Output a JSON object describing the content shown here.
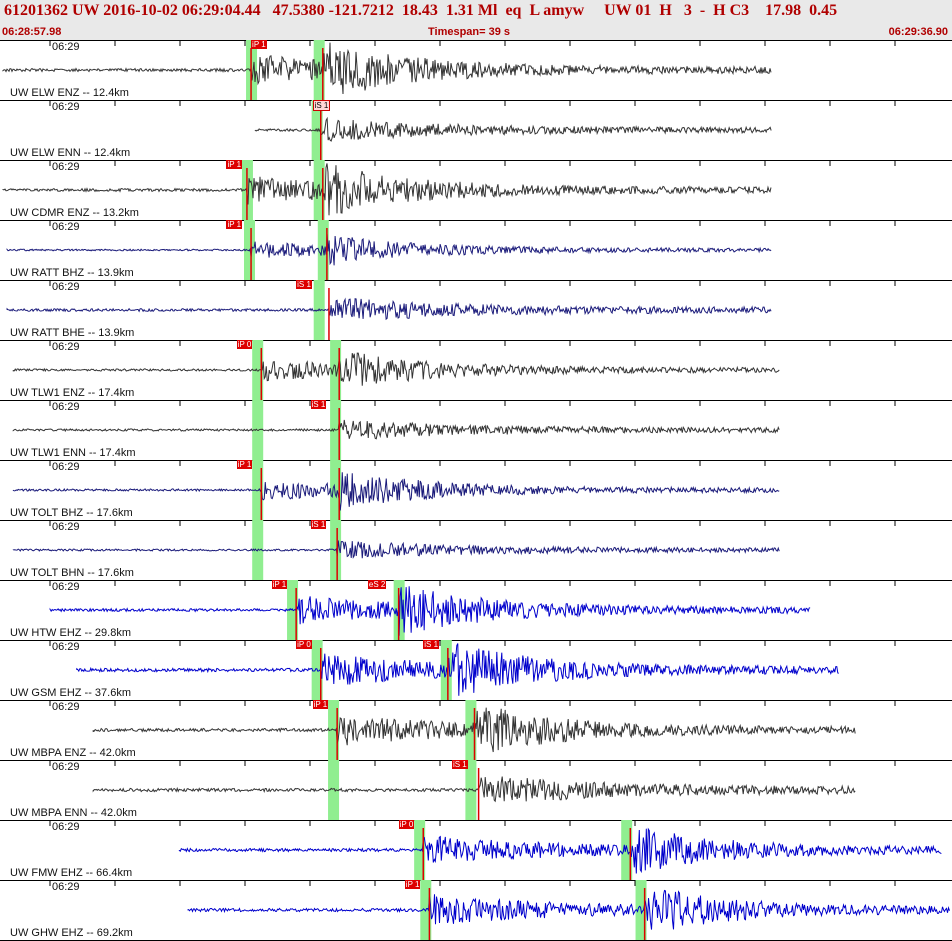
{
  "header": {
    "event_line": "61201362 UW 2016-10-02 06:29:04.44   47.5380 -121.7212  18.43  1.31 Ml  eq  L amyw     UW 01  H   3  -  H C3    17.98  0.45",
    "start_time": "06:28:57.98",
    "timespan": "Timespan=  39 s",
    "end_time": "06:29:36.90"
  },
  "colors": {
    "header_bg": "#e9e9e9",
    "pick": "#dd0000",
    "pick_window": "#90ee90",
    "trace_black": "#333333",
    "trace_navy": "#1a1a7a",
    "trace_blue": "#0000cc"
  },
  "channels": [
    {
      "label": "UW ELW ENZ -- 12.4km",
      "tick": "06:29",
      "color": "#333333",
      "amp": 13,
      "trace_start_s": 0,
      "trace_end_s": 37.5,
      "picks": [
        {
          "text": "iP 1",
          "t_s": 12.1,
          "style": "red"
        }
      ],
      "windows": [
        12.1,
        15.4
      ],
      "onsets": [
        12.1,
        15.6
      ]
    },
    {
      "label": "UW ELW ENN -- 12.4km",
      "tick": "06:29",
      "color": "#333333",
      "amp": 10,
      "trace_start_s": 12.3,
      "trace_end_s": 37.5,
      "picks": [
        {
          "text": "iS 1",
          "t_s": 15.1,
          "style": "pink"
        }
      ],
      "windows": [
        15.3
      ],
      "onsets": [
        15.5
      ]
    },
    {
      "label": "UW CDMR ENZ -- 13.2km",
      "tick": "06:29",
      "color": "#333333",
      "amp": 12,
      "trace_start_s": 0,
      "trace_end_s": 37.5,
      "picks": [
        {
          "text": "iP 1",
          "t_s": 10.9,
          "style": "red"
        }
      ],
      "windows": [
        11.9,
        15.4
      ],
      "onsets": [
        11.9,
        15.6
      ]
    },
    {
      "label": "UW RATT BHZ -- 13.9km",
      "tick": "06:29",
      "color": "#1a1a7a",
      "amp": 7,
      "trace_start_s": 0.2,
      "trace_end_s": 37.5,
      "picks": [
        {
          "text": "iP 1",
          "t_s": 10.9,
          "style": "red"
        }
      ],
      "windows": [
        12.0,
        15.6
      ],
      "onsets": [
        12.1,
        15.8
      ]
    },
    {
      "label": "UW RATT BHE -- 13.9km",
      "tick": "06:29",
      "color": "#1a1a7a",
      "amp": 11,
      "trace_start_s": 0.2,
      "trace_end_s": 37.5,
      "picks": [
        {
          "text": "iS 1",
          "t_s": 14.3,
          "style": "red"
        }
      ],
      "windows": [
        15.4
      ],
      "onsets": [
        15.9
      ]
    },
    {
      "label": "UW TLW1 ENZ -- 17.4km",
      "tick": "06:29",
      "color": "#333333",
      "amp": 9,
      "trace_start_s": 0.5,
      "trace_end_s": 37.9,
      "picks": [
        {
          "text": "iP 0",
          "t_s": 11.4,
          "style": "red"
        }
      ],
      "windows": [
        12.4,
        16.2
      ],
      "onsets": [
        12.6,
        16.4
      ]
    },
    {
      "label": "UW TLW1 ENN -- 17.4km",
      "tick": "06:29",
      "color": "#333333",
      "amp": 9,
      "trace_start_s": 0.5,
      "trace_end_s": 37.9,
      "picks": [
        {
          "text": "iS 1",
          "t_s": 15.0,
          "style": "red"
        }
      ],
      "windows": [
        12.4,
        16.2
      ],
      "onsets": [
        16.4
      ]
    },
    {
      "label": "UW TOLT BHZ -- 17.6km",
      "tick": "06:29",
      "color": "#1a1a7a",
      "amp": 9,
      "trace_start_s": 0.5,
      "trace_end_s": 37.9,
      "picks": [
        {
          "text": "iP 1",
          "t_s": 11.4,
          "style": "red"
        }
      ],
      "windows": [
        12.4,
        16.2
      ],
      "onsets": [
        12.6,
        16.4
      ]
    },
    {
      "label": "UW TOLT BHN -- 17.6km",
      "tick": "06:29",
      "color": "#1a1a7a",
      "amp": 8,
      "trace_start_s": 0.5,
      "trace_end_s": 37.9,
      "picks": [
        {
          "text": "iS 1",
          "t_s": 15.0,
          "style": "red"
        }
      ],
      "windows": [
        12.4,
        16.2
      ],
      "onsets": [
        16.3
      ]
    },
    {
      "label": "UW HTW EHZ -- 29.8km",
      "tick": "06:29",
      "color": "#0000cc",
      "amp": 12,
      "trace_start_s": 2.3,
      "trace_end_s": 39.4,
      "picks": [
        {
          "text": "iP 1",
          "t_s": 13.1,
          "style": "red"
        },
        {
          "text": "eS 2",
          "t_s": 17.8,
          "style": "red"
        }
      ],
      "windows": [
        14.1,
        19.3
      ],
      "onsets": [
        14.3,
        19.3
      ]
    },
    {
      "label": "UW GSM EHZ -- 37.6km",
      "tick": "06:29",
      "color": "#0000cc",
      "amp": 14,
      "trace_start_s": 3.6,
      "trace_end_s": 40.8,
      "picks": [
        {
          "text": "iP 0",
          "t_s": 14.3,
          "style": "red"
        },
        {
          "text": "iS 1",
          "t_s": 20.5,
          "style": "red"
        }
      ],
      "windows": [
        15.3,
        21.6
      ],
      "onsets": [
        15.5,
        21.7
      ]
    },
    {
      "label": "UW MBPA ENZ -- 42.0km",
      "tick": "06:29",
      "color": "#333333",
      "amp": 13,
      "trace_start_s": 4.4,
      "trace_end_s": 41.6,
      "picks": [
        {
          "text": "iP 1",
          "t_s": 15.1,
          "style": "red"
        }
      ],
      "windows": [
        16.1,
        22.8
      ],
      "onsets": [
        16.3,
        23.0
      ]
    },
    {
      "label": "UW MBPA ENN -- 42.0km",
      "tick": "06:29",
      "color": "#333333",
      "amp": 13,
      "trace_start_s": 4.4,
      "trace_end_s": 41.6,
      "picks": [
        {
          "text": "iS 1",
          "t_s": 21.9,
          "style": "red"
        }
      ],
      "windows": [
        16.1,
        22.8
      ],
      "onsets": [
        23.2
      ]
    },
    {
      "label": "UW FMW EHZ -- 66.4km",
      "tick": "06:29",
      "color": "#0000cc",
      "amp": 13,
      "trace_start_s": 8.6,
      "trace_end_s": 45.8,
      "picks": [
        {
          "text": "iP 0",
          "t_s": 19.3,
          "style": "red"
        }
      ],
      "windows": [
        20.3,
        30.4
      ],
      "onsets": [
        20.5,
        30.6
      ]
    },
    {
      "label": "UW GHW EHZ -- 69.2km",
      "tick": "06:29",
      "color": "#0000cc",
      "amp": 13,
      "trace_start_s": 9.0,
      "trace_end_s": 46.2,
      "picks": [
        {
          "text": "iP 1",
          "t_s": 19.6,
          "style": "red"
        }
      ],
      "windows": [
        20.6,
        31.1
      ],
      "onsets": [
        20.8,
        31.3
      ]
    }
  ]
}
